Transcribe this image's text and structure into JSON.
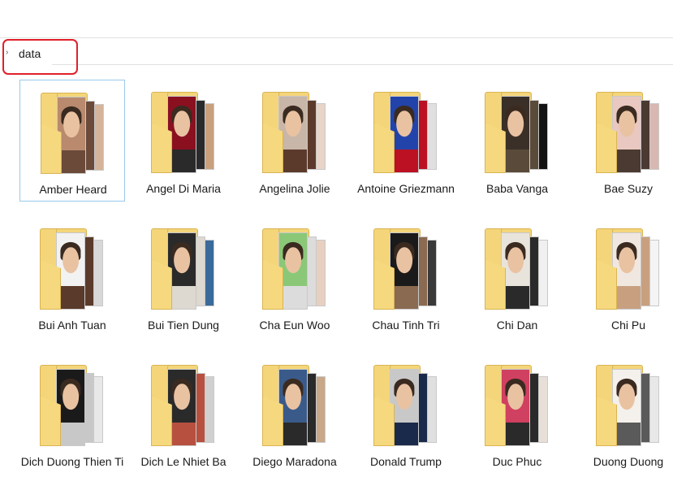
{
  "group": {
    "name": "data"
  },
  "folders": [
    {
      "label": "Amber Heard",
      "selected": true,
      "colors": [
        "#b98a6e",
        "#6b4a3a",
        "#d4b49a"
      ]
    },
    {
      "label": "Angel Di Maria",
      "colors": [
        "#8a1020",
        "#2a2a2a",
        "#c9a07c"
      ]
    },
    {
      "label": "Angelina Jolie",
      "colors": [
        "#c8b6a8",
        "#5b3a2c",
        "#e8d5c8"
      ]
    },
    {
      "label": "Antoine Griezmann",
      "colors": [
        "#2244aa",
        "#bb1122",
        "#e0e0e0"
      ]
    },
    {
      "label": "Baba Vanga",
      "colors": [
        "#3a3028",
        "#5a4a3a",
        "#121212"
      ]
    },
    {
      "label": "Bae Suzy",
      "colors": [
        "#e8c8c0",
        "#4a3a32",
        "#d8b8b0"
      ]
    },
    {
      "label": "Bui Anh Tuan",
      "colors": [
        "#f2f2f2",
        "#5a3a2a",
        "#d8d8d8"
      ]
    },
    {
      "label": "Bui Tien Dung",
      "colors": [
        "#2a2a2a",
        "#ddd8d0",
        "#3a6a9a"
      ]
    },
    {
      "label": "Cha Eun Woo",
      "colors": [
        "#8ac878",
        "#dcdcdc",
        "#e8d0c0"
      ]
    },
    {
      "label": "Chau Tinh Tri",
      "colors": [
        "#1a1a1a",
        "#8a6a50",
        "#3a3a3a"
      ]
    },
    {
      "label": "Chi Dan",
      "colors": [
        "#e8e4dc",
        "#2a2a2a",
        "#f0f0f0"
      ]
    },
    {
      "label": "Chi Pu",
      "colors": [
        "#f0e8e0",
        "#c8a080",
        "#f4f4f4"
      ]
    },
    {
      "label": "Dich Duong Thien Ti",
      "colors": [
        "#1a1a1a",
        "#c8c8c8",
        "#e8e8e8"
      ]
    },
    {
      "label": "Dich Le Nhiet Ba",
      "colors": [
        "#2a2a2a",
        "#b85040",
        "#d0d0d0"
      ]
    },
    {
      "label": "Diego Maradona",
      "colors": [
        "#3a5a8a",
        "#2a2a2a",
        "#c8a888"
      ]
    },
    {
      "label": "Donald Trump",
      "colors": [
        "#c8c8c8",
        "#1a2a4a",
        "#e0e0e0"
      ]
    },
    {
      "label": "Duc Phuc",
      "colors": [
        "#d04060",
        "#2a2a2a",
        "#e8e0d8"
      ]
    },
    {
      "label": "Duong Duong",
      "colors": [
        "#f4f0ec",
        "#5a5a5a",
        "#e8e8e8"
      ]
    }
  ]
}
